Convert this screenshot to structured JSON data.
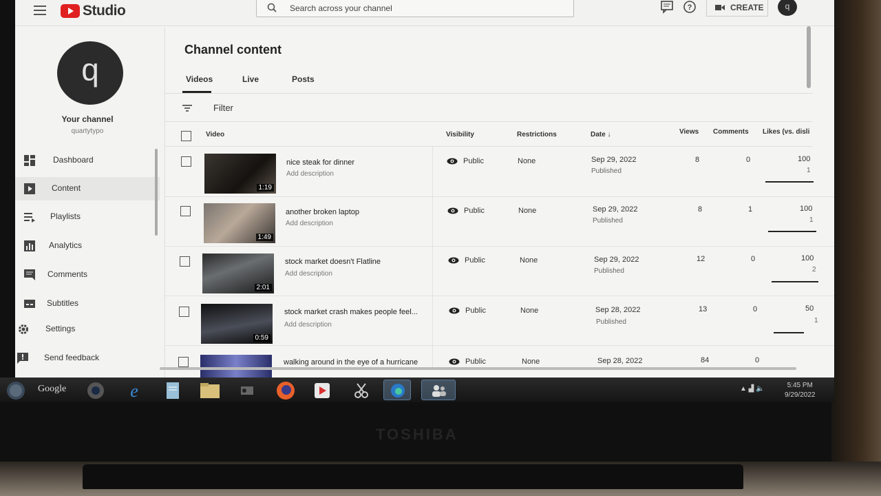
{
  "app": {
    "logo_text": "Studio",
    "search_placeholder": "Search across your channel",
    "create_label": "CREATE",
    "avatar_letter": "q"
  },
  "channel": {
    "avatar_letter": "q",
    "title": "Your channel",
    "handle": "quartytypo"
  },
  "sidebar": {
    "items": [
      {
        "label": "Dashboard",
        "icon": "dashboard-icon"
      },
      {
        "label": "Content",
        "icon": "content-icon",
        "active": true
      },
      {
        "label": "Playlists",
        "icon": "playlists-icon"
      },
      {
        "label": "Analytics",
        "icon": "analytics-icon"
      },
      {
        "label": "Comments",
        "icon": "comments-icon"
      },
      {
        "label": "Subtitles",
        "icon": "subtitles-icon"
      },
      {
        "label": "Settings",
        "icon": "gear-icon"
      },
      {
        "label": "Send feedback",
        "icon": "feedback-icon"
      }
    ]
  },
  "page": {
    "title": "Channel content",
    "tabs": [
      "Videos",
      "Live",
      "Posts"
    ],
    "filter_label": "Filter"
  },
  "table": {
    "headers": {
      "video": "Video",
      "visibility": "Visibility",
      "restrictions": "Restrictions",
      "date": "Date",
      "views": "Views",
      "comments": "Comments",
      "likes": "Likes (vs. disli"
    },
    "rows": [
      {
        "title": "nice steak for dinner",
        "desc": "Add description",
        "duration": "1:19",
        "visibility": "Public",
        "restrictions": "None",
        "date": "Sep 29, 2022",
        "status": "Published",
        "views": "8",
        "comments": "0",
        "likes": "100",
        "likes_sub": "1"
      },
      {
        "title": "another broken laptop",
        "desc": "Add description",
        "duration": "1:49",
        "visibility": "Public",
        "restrictions": "None",
        "date": "Sep 29, 2022",
        "status": "Published",
        "views": "8",
        "comments": "1",
        "likes": "100",
        "likes_sub": "1"
      },
      {
        "title": "stock market doesn't Flatline",
        "desc": "Add description",
        "duration": "2:01",
        "visibility": "Public",
        "restrictions": "None",
        "date": "Sep 29, 2022",
        "status": "Published",
        "views": "12",
        "comments": "0",
        "likes": "100",
        "likes_sub": "2"
      },
      {
        "title": "stock market crash makes people feel...",
        "desc": "Add description",
        "duration": "0:59",
        "visibility": "Public",
        "restrictions": "None",
        "date": "Sep 28, 2022",
        "status": "Published",
        "views": "13",
        "comments": "0",
        "likes": "50",
        "likes_sub": "1"
      },
      {
        "title": "walking around in the eye of a hurricane",
        "desc": "",
        "duration": "",
        "visibility": "Public",
        "restrictions": "None",
        "date": "Sep 28, 2022",
        "status": "",
        "views": "84",
        "comments": "0",
        "likes": "",
        "likes_sub": ""
      }
    ]
  },
  "taskbar": {
    "google_label": "Google",
    "time": "5:45 PM",
    "date": "9/29/2022"
  },
  "hardware": {
    "brand": "TOSHIBA"
  }
}
